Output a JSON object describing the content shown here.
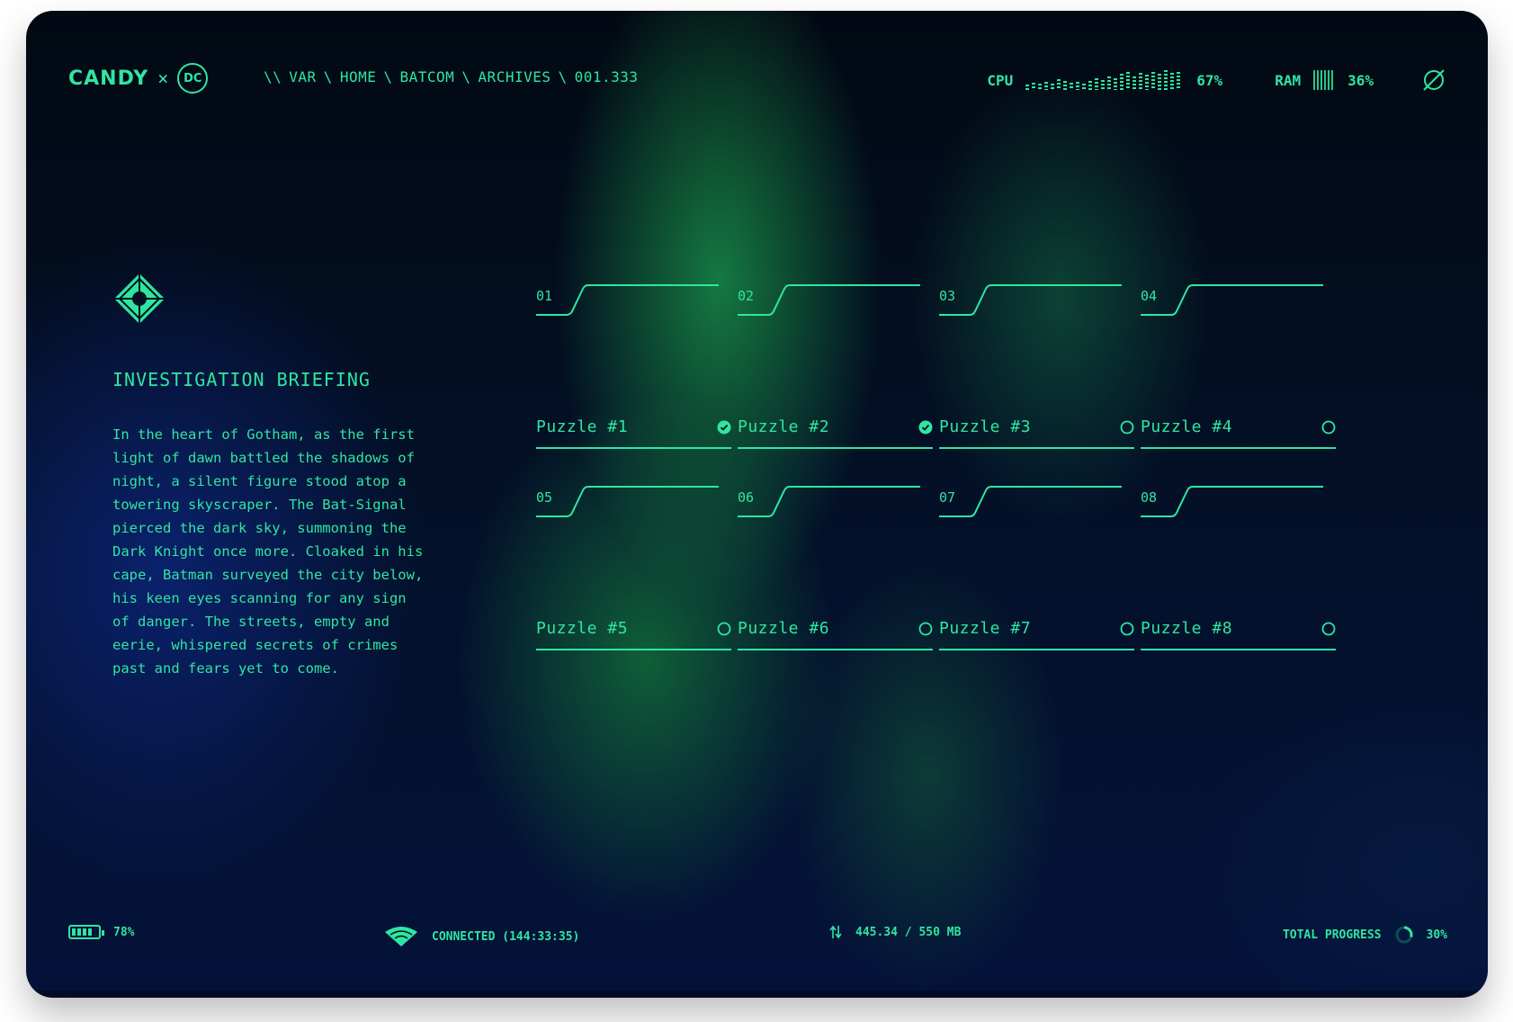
{
  "header": {
    "logo_brand": "CANDY",
    "logo_separator": "×",
    "logo_partner": "DC",
    "breadcrumb": [
      "\\\\",
      "VAR",
      "\\",
      "HOME",
      "\\",
      "BATCOM",
      "\\",
      "ARCHIVES",
      "\\",
      "001.333"
    ],
    "cpu": {
      "label": "CPU",
      "value": "67%",
      "bars": [
        0.25,
        0.35,
        0.3,
        0.4,
        0.3,
        0.55,
        0.45,
        0.35,
        0.4,
        0.3,
        0.45,
        0.6,
        0.5,
        0.7,
        0.6,
        0.8,
        0.9,
        0.7,
        0.85,
        0.75,
        0.9,
        0.8,
        1.0,
        0.85,
        0.9
      ],
      "filled_fraction": 0.67
    },
    "ram": {
      "label": "RAM",
      "value": "36%",
      "filled_fraction": 0.36
    },
    "icons": {
      "settings": "null-circle-icon"
    }
  },
  "briefing": {
    "icon": "batcom-diamond-icon",
    "title": "INVESTIGATION BRIEFING",
    "body": "In the heart of Gotham, as the first\nlight of dawn battled the shadows of\nnight, a silent figure stood atop a\ntowering skyscraper. The Bat-Signal\npierced the dark sky, summoning the\nDark Knight once more. Cloaked in his\ncape, Batman surveyed the city below,\nhis keen eyes scanning for any sign\nof danger. The streets, empty and\neerie, whispered secrets of crimes\npast and fears yet to come."
  },
  "puzzles": [
    {
      "num": "01",
      "label": "Puzzle #1",
      "done": true
    },
    {
      "num": "02",
      "label": "Puzzle #2",
      "done": true
    },
    {
      "num": "03",
      "label": "Puzzle #3",
      "done": false
    },
    {
      "num": "04",
      "label": "Puzzle #4",
      "done": false
    },
    {
      "num": "05",
      "label": "Puzzle #5",
      "done": false
    },
    {
      "num": "06",
      "label": "Puzzle #6",
      "done": false
    },
    {
      "num": "07",
      "label": "Puzzle #7",
      "done": false
    },
    {
      "num": "08",
      "label": "Puzzle #8",
      "done": false
    }
  ],
  "footer": {
    "battery": {
      "value": "78%",
      "level": 0.78
    },
    "connection": {
      "text": "CONNECTED (144:33:35)",
      "icon": "wifi-icon"
    },
    "transfer": {
      "text": "445.34 / 550 MB",
      "icon": "transfer-arrows-icon"
    },
    "progress": {
      "label": "TOTAL PROGRESS",
      "value": "30%",
      "fraction": 0.3
    }
  },
  "colors": {
    "accent": "#2fe6a0",
    "bg_dark": "#020913",
    "bg_blue": "#0c2478",
    "bg_green": "#188c46"
  }
}
